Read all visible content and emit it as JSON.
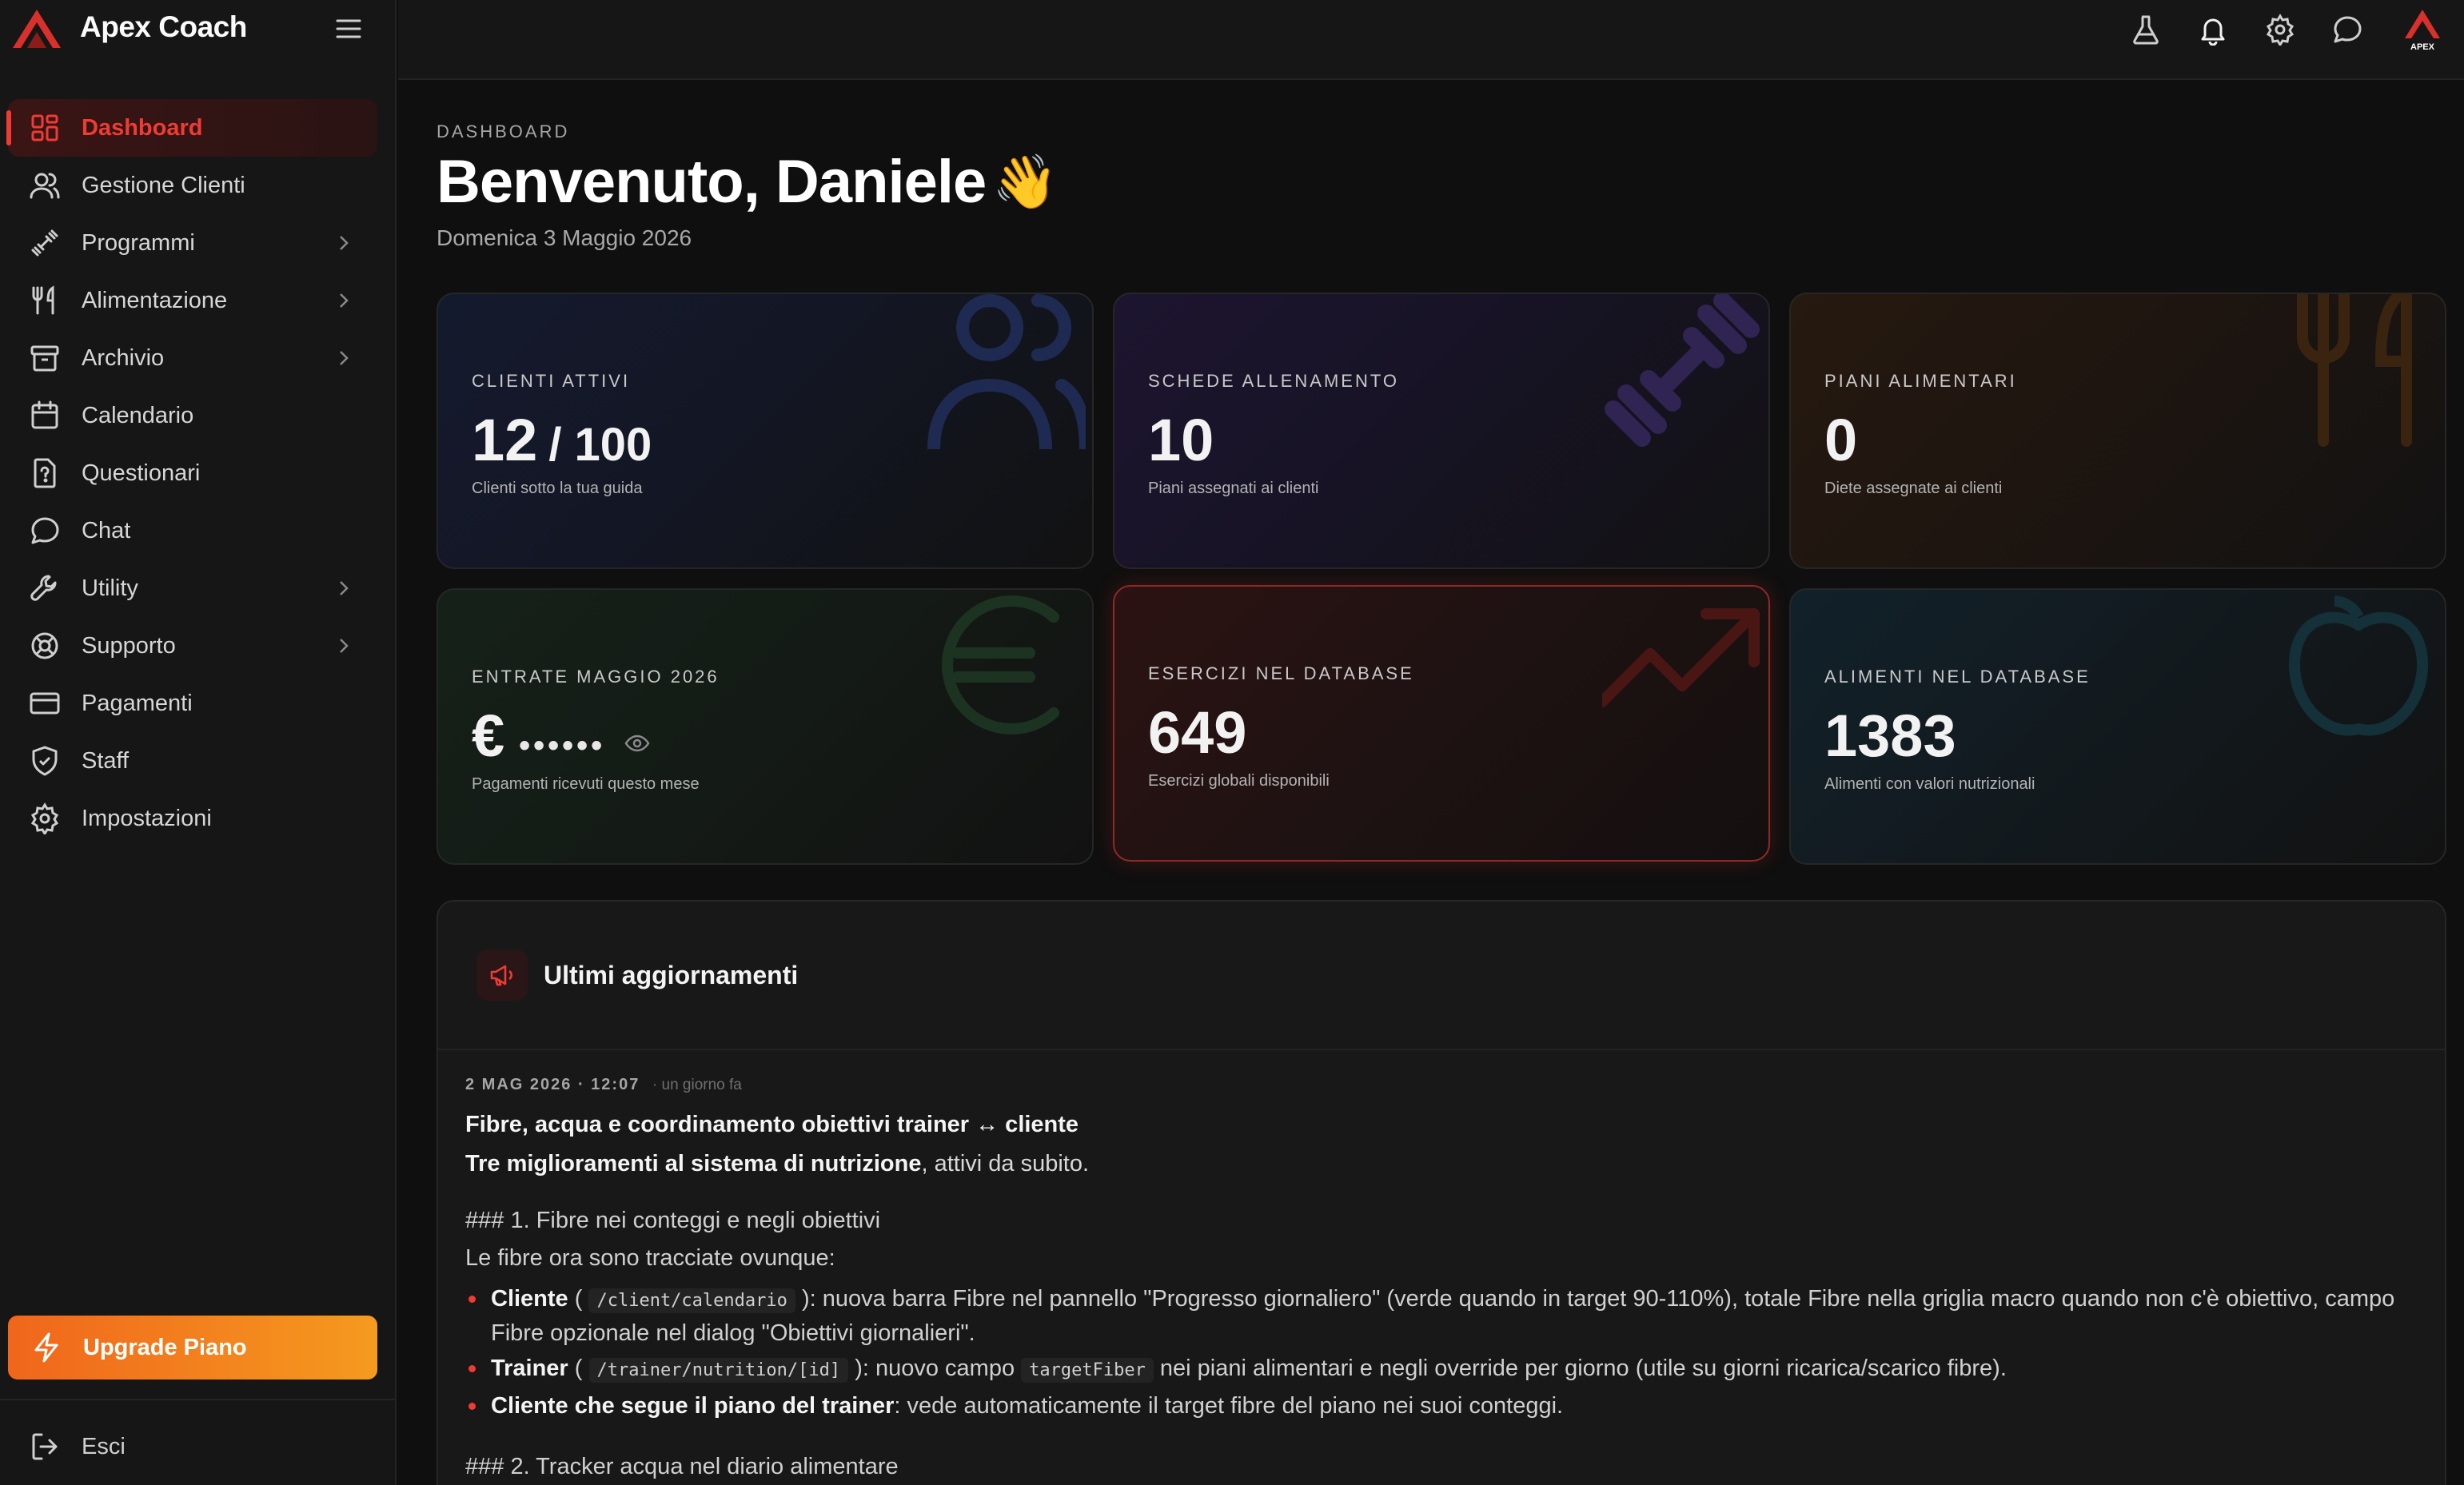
{
  "app": {
    "name": "Apex Coach",
    "logo_text": "APEX"
  },
  "sidebar": {
    "items": [
      {
        "label": "Dashboard",
        "icon": "dashboard-icon",
        "active": true
      },
      {
        "label": "Gestione Clienti",
        "icon": "users-icon"
      },
      {
        "label": "Programmi",
        "icon": "dumbbell-icon",
        "has_submenu": true
      },
      {
        "label": "Alimentazione",
        "icon": "utensils-icon",
        "has_submenu": true
      },
      {
        "label": "Archivio",
        "icon": "archive-icon",
        "has_submenu": true
      },
      {
        "label": "Calendario",
        "icon": "calendar-icon"
      },
      {
        "label": "Questionari",
        "icon": "questionnaire-icon"
      },
      {
        "label": "Chat",
        "icon": "chat-icon"
      },
      {
        "label": "Utility",
        "icon": "wrench-icon",
        "has_submenu": true
      },
      {
        "label": "Supporto",
        "icon": "lifebuoy-icon",
        "has_submenu": true
      },
      {
        "label": "Pagamenti",
        "icon": "credit-card-icon"
      },
      {
        "label": "Staff",
        "icon": "shield-icon"
      },
      {
        "label": "Impostazioni",
        "icon": "gear-icon"
      }
    ],
    "upgrade_label": "Upgrade Piano",
    "logout_label": "Esci"
  },
  "topbar": {
    "icons": [
      "flask-icon",
      "bell-icon",
      "gear-icon",
      "chat-icon"
    ]
  },
  "header": {
    "breadcrumb": "DASHBOARD",
    "title": "Benvenuto, Daniele",
    "emoji": "👋",
    "date": "Domenica 3 Maggio 2026"
  },
  "stats": {
    "clients": {
      "label": "CLIENTI ATTIVI",
      "value": "12",
      "max": "/ 100",
      "desc": "Clienti sotto la tua guida"
    },
    "workouts": {
      "label": "SCHEDE ALLENAMENTO",
      "value": "10",
      "desc": "Piani assegnati ai clienti"
    },
    "meal_plans": {
      "label": "PIANI ALIMENTARI",
      "value": "0",
      "desc": "Diete assegnate ai clienti"
    },
    "revenue": {
      "label": "ENTRATE MAGGIO 2026",
      "currency": "€",
      "masked": "••••••",
      "desc": "Pagamenti ricevuti questo mese"
    },
    "exercises": {
      "label": "ESERCIZI NEL DATABASE",
      "value": "649",
      "desc": "Esercizi globali disponibili"
    },
    "foods": {
      "label": "ALIMENTI NEL DATABASE",
      "value": "1383",
      "desc": "Alimenti con valori nutrizionali"
    }
  },
  "updates": {
    "title": "Ultimi aggiornamenti",
    "entry": {
      "meta": "2 MAG 2026 · 12:07",
      "ago": "· un giorno fa",
      "title": "Fibre, acqua e coordinamento obiettivi trainer ↔ cliente",
      "intro_bold": "Tre miglioramenti al sistema di nutrizione",
      "intro_rest": ", attivi da subito.",
      "h1": "### 1. Fibre nei conteggi e negli obiettivi",
      "para": "Le fibre ora sono tracciate ovunque:",
      "bullets": [
        {
          "bold": "Cliente",
          "pre": " ( ",
          "code": "/client/calendario",
          "text": " ): nuova barra Fibre nel pannello \"Progresso giornaliero\" (verde quando in target 90-110%), totale Fibre nella griglia macro quando non c'è obiettivo, campo Fibre opzionale nel dialog \"Obiettivi giornalieri\"."
        },
        {
          "bold": "Trainer",
          "pre": " ( ",
          "code": "/trainer/nutrition/[id]",
          "text": " ): nuovo campo ",
          "code2": "targetFiber",
          "text2": " nei piani alimentari e negli override per giorno (utile su giorni ricarica/scarico fibre)."
        },
        {
          "bold": "Cliente che segue il piano del trainer",
          "text": ": vede automaticamente il target fibre del piano nei suoi conteggi."
        }
      ],
      "h2": "### 2. Tracker acqua nel diario alimentare"
    }
  },
  "colors": {
    "accent": "#ef3b33",
    "upgrade_start": "#f0661c",
    "upgrade_end": "#f59a1f"
  }
}
